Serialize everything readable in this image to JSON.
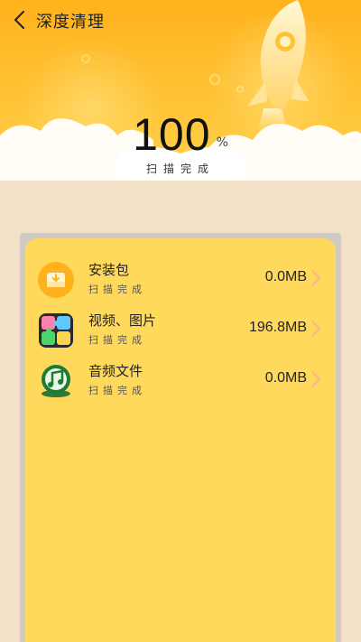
{
  "header": {
    "title": "深度清理",
    "back_icon": "chevron-left-icon",
    "percent": "100",
    "percent_unit": "%",
    "status": "扫描完成",
    "colors": {
      "primary": "#ffb21c",
      "light": "#ffd24d",
      "cloud": "#ffffff"
    }
  },
  "card": {
    "background": "#ffd95c",
    "items": [
      {
        "icon": "apk-package-icon",
        "name": "安装包",
        "status": "扫描完成",
        "size": "0.0MB"
      },
      {
        "icon": "media-puzzle-icon",
        "name": "视频、图片",
        "status": "扫描完成",
        "size": "196.8MB"
      },
      {
        "icon": "music-note-icon",
        "name": "音频文件",
        "status": "扫描完成",
        "size": "0.0MB"
      }
    ]
  }
}
